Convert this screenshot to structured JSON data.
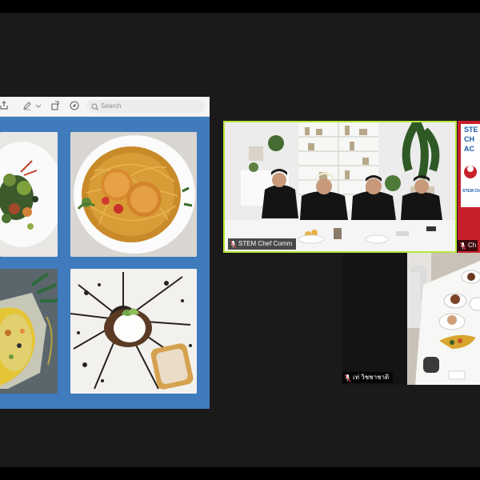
{
  "share": {
    "search_placeholder": "Search"
  },
  "participants": [
    {
      "name": "STEM Chef Comm",
      "muted": true
    },
    {
      "name": "Ch",
      "muted": true
    },
    {
      "name": "เท่ วิชชาชาติ",
      "muted": true
    }
  ],
  "side_banner": {
    "line1": "STE",
    "line2": "CH",
    "line3": "AC",
    "caption": "STEM Ch"
  },
  "colors": {
    "active_speaker_border": "#b6e63a",
    "share_background": "#3f7bbd",
    "side_banner_red": "#d1272d",
    "side_banner_blue": "#1f5aa8"
  }
}
